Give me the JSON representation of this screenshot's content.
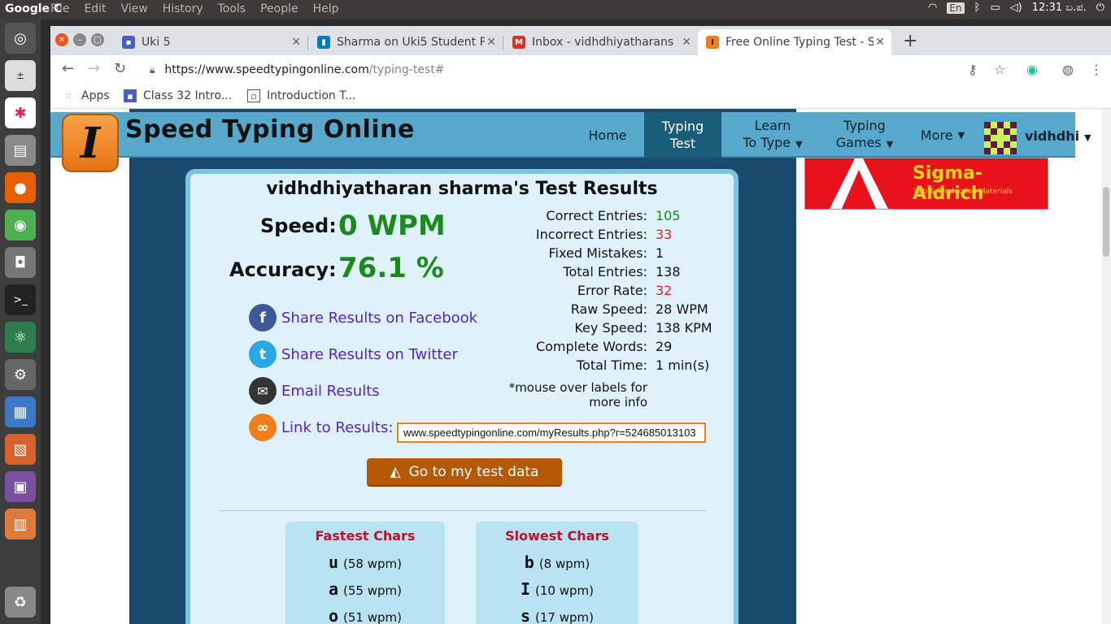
{
  "system": {
    "app_name": "Google C",
    "menus": [
      "File",
      "Edit",
      "View",
      "History",
      "Tools",
      "People",
      "Help"
    ],
    "lang": "En",
    "time": "12:31 ಬ.ಪ."
  },
  "browser": {
    "tabs": [
      {
        "title": "Uki 5",
        "favicon": "google-classroom-icon",
        "color": "#4a5ec0",
        "active": false
      },
      {
        "title": "Sharma on Uki5 Student P",
        "favicon": "trello-icon",
        "color": "#0079bf",
        "active": false
      },
      {
        "title": "Inbox - vidhdhiyatharans",
        "favicon": "gmail-icon",
        "color": "#d93025",
        "active": false
      },
      {
        "title": "Free Online Typing Test - S",
        "favicon": "speedtyping-icon",
        "color": "#f07e1a",
        "active": true
      }
    ],
    "url_host": "https://www.speedtypingonline.com",
    "url_path": "/typing-test#",
    "bookmarks": [
      {
        "label": "Apps"
      },
      {
        "label": "Class 32 Intro..."
      },
      {
        "label": "Introduction T..."
      }
    ]
  },
  "site": {
    "name": "Speed Typing Online",
    "logo_letter": "I",
    "nav": {
      "home": "Home",
      "typing_test": [
        "Typing",
        "Test"
      ],
      "learn": [
        "Learn",
        "To Type"
      ],
      "games": [
        "Typing",
        "Games"
      ],
      "more": "More",
      "user": "vidhdhi"
    }
  },
  "ad": {
    "brand": "Sigma-Aldrich",
    "tagline": "Lab & Production Materials"
  },
  "results": {
    "title": "vidhdhiyatharan sharma's Test Results",
    "speed_label": "Speed:",
    "speed_value": "0 WPM",
    "accuracy_label": "Accuracy:",
    "accuracy_value": "76.1 %",
    "share": {
      "facebook": "Share Results on Facebook",
      "twitter": "Share Results on Twitter",
      "email": "Email Results",
      "link": "Link to Results:"
    },
    "link_url": "www.speedtypingonline.com/myResults.php?r=524685013103",
    "stats": [
      {
        "label": "Correct Entries:",
        "value": "105",
        "color": "green"
      },
      {
        "label": "Incorrect Entries:",
        "value": "33",
        "color": "red"
      },
      {
        "label": "Fixed Mistakes:",
        "value": "1",
        "color": ""
      },
      {
        "label": "Total Entries:",
        "value": "138",
        "color": ""
      },
      {
        "label": "Error Rate:",
        "value": "32",
        "color": "red"
      },
      {
        "label": "Raw Speed:",
        "value": "28 WPM",
        "color": ""
      },
      {
        "label": "Key Speed:",
        "value": "138 KPM",
        "color": ""
      },
      {
        "label": "Complete Words:",
        "value": "29",
        "color": ""
      },
      {
        "label": "Total Time:",
        "value": "1 min(s)",
        "color": ""
      }
    ],
    "mouse_note": "*mouse over labels for more info",
    "test_data_button": "Go to my test data",
    "fastest": {
      "heading": "Fastest Chars",
      "rows": [
        {
          "char": "u",
          "wpm": "(58 wpm)"
        },
        {
          "char": "a",
          "wpm": "(55 wpm)"
        },
        {
          "char": "o",
          "wpm": "(51 wpm)"
        }
      ]
    },
    "slowest": {
      "heading": "Slowest Chars",
      "rows": [
        {
          "char": "b",
          "wpm": "(8 wpm)"
        },
        {
          "char": "I",
          "wpm": "(10 wpm)"
        },
        {
          "char": "s",
          "wpm": "(17 wpm)"
        }
      ]
    }
  }
}
